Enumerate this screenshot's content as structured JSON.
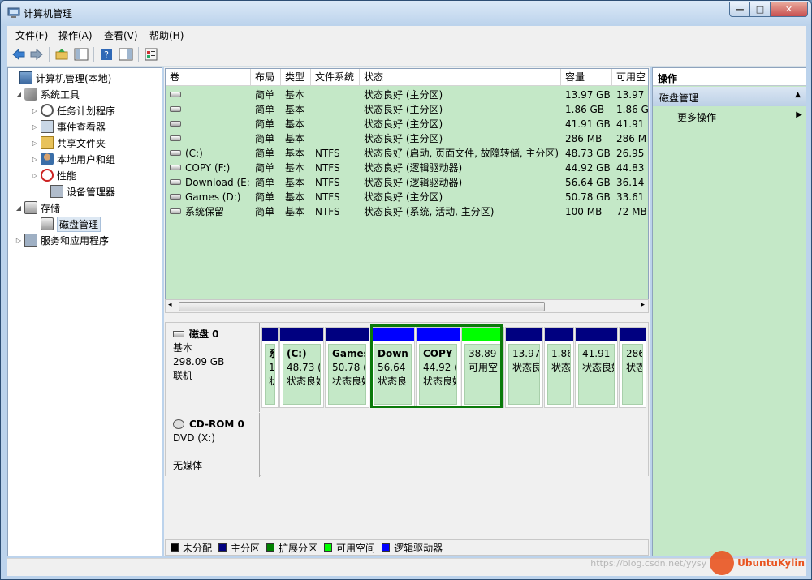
{
  "window": {
    "title": "计算机管理",
    "buttons": {
      "minimize": "—",
      "maximize": "□",
      "close": "✕"
    }
  },
  "menu": [
    "文件(F)",
    "操作(A)",
    "查看(V)",
    "帮助(H)"
  ],
  "tree": [
    {
      "label": "计算机管理(本地)",
      "icon": "computer-icon",
      "arrow": ""
    },
    {
      "label": "系统工具",
      "icon": "tools-icon",
      "arrow": "◢"
    },
    {
      "label": "任务计划程序",
      "icon": "clock-icon",
      "arrow": "▷"
    },
    {
      "label": "事件查看器",
      "icon": "event-viewer-icon",
      "arrow": "▷"
    },
    {
      "label": "共享文件夹",
      "icon": "shared-folder-icon",
      "arrow": "▷"
    },
    {
      "label": "本地用户和组",
      "icon": "users-icon",
      "arrow": "▷"
    },
    {
      "label": "性能",
      "icon": "performance-icon",
      "arrow": "▷"
    },
    {
      "label": "设备管理器",
      "icon": "device-manager-icon",
      "arrow": ""
    },
    {
      "label": "存储",
      "icon": "storage-icon",
      "arrow": "◢"
    },
    {
      "label": "磁盘管理",
      "icon": "disk-management-icon",
      "arrow": ""
    },
    {
      "label": "服务和应用程序",
      "icon": "services-icon",
      "arrow": "▷"
    }
  ],
  "volumes": {
    "columns": [
      "卷",
      "布局",
      "类型",
      "文件系统",
      "状态",
      "容量",
      "可用空"
    ],
    "rows": [
      [
        "",
        "简单",
        "基本",
        "",
        "状态良好 (主分区)",
        "13.97 GB",
        "13.97 ("
      ],
      [
        "",
        "简单",
        "基本",
        "",
        "状态良好 (主分区)",
        "1.86 GB",
        "1.86 G"
      ],
      [
        "",
        "简单",
        "基本",
        "",
        "状态良好 (主分区)",
        "41.91 GB",
        "41.91 ("
      ],
      [
        "",
        "简单",
        "基本",
        "",
        "状态良好 (主分区)",
        "286 MB",
        "286 M"
      ],
      [
        "(C:)",
        "简单",
        "基本",
        "NTFS",
        "状态良好 (启动, 页面文件, 故障转储, 主分区)",
        "48.73 GB",
        "26.95 ("
      ],
      [
        "COPY (F:)",
        "简单",
        "基本",
        "NTFS",
        "状态良好 (逻辑驱动器)",
        "44.92 GB",
        "44.83 ("
      ],
      [
        "Download (E:)",
        "简单",
        "基本",
        "NTFS",
        "状态良好 (逻辑驱动器)",
        "56.64 GB",
        "36.14 ("
      ],
      [
        "Games (D:)",
        "简单",
        "基本",
        "NTFS",
        "状态良好 (主分区)",
        "50.78 GB",
        "33.61 ("
      ],
      [
        "系统保留",
        "简单",
        "基本",
        "NTFS",
        "状态良好 (系统, 活动, 主分区)",
        "100 MB",
        "72 MB"
      ]
    ]
  },
  "disk0": {
    "name": "磁盘 0",
    "type": "基本",
    "size": "298.09 GB",
    "status": "联机"
  },
  "partitions": [
    {
      "name": "系",
      "l2": "1",
      "l3": "状",
      "color": "#000080"
    },
    {
      "name": "(C:)",
      "l2": "48.73 (",
      "l3": "状态良好",
      "color": "#000080"
    },
    {
      "name": "Games",
      "l2": "50.78 (",
      "l3": "状态良好",
      "color": "#000080"
    },
    {
      "name": "Down",
      "l2": "56.64",
      "l3": "状态良",
      "color": "#0000ff"
    },
    {
      "name": "COPY",
      "l2": "44.92 (",
      "l3": "状态良好",
      "color": "#0000ff"
    },
    {
      "name": "",
      "l2": "38.89",
      "l3": "可用空",
      "color": "#00ff00"
    },
    {
      "name": "",
      "l2": "13.97",
      "l3": "状态良",
      "color": "#000080"
    },
    {
      "name": "",
      "l2": "1.86",
      "l3": "状态",
      "color": "#000080"
    },
    {
      "name": "",
      "l2": "41.91 (",
      "l3": "状态良好",
      "color": "#000080"
    },
    {
      "name": "",
      "l2": "286",
      "l3": "状态",
      "color": "#000080"
    }
  ],
  "cdrom": {
    "name": "CD-ROM 0",
    "drive": "DVD (X:)",
    "media": "无媒体"
  },
  "legend": [
    {
      "label": "未分配",
      "color": "#000000"
    },
    {
      "label": "主分区",
      "color": "#000080"
    },
    {
      "label": "扩展分区",
      "color": "#008000"
    },
    {
      "label": "可用空间",
      "color": "#00ff00"
    },
    {
      "label": "逻辑驱动器",
      "color": "#0000ff"
    }
  ],
  "actions": {
    "header": "操作",
    "section": "磁盘管理",
    "item": "更多操作"
  },
  "watermark": {
    "url": "https://blog.csdn.net/yysy",
    "brand": "UbuntuKylin"
  }
}
